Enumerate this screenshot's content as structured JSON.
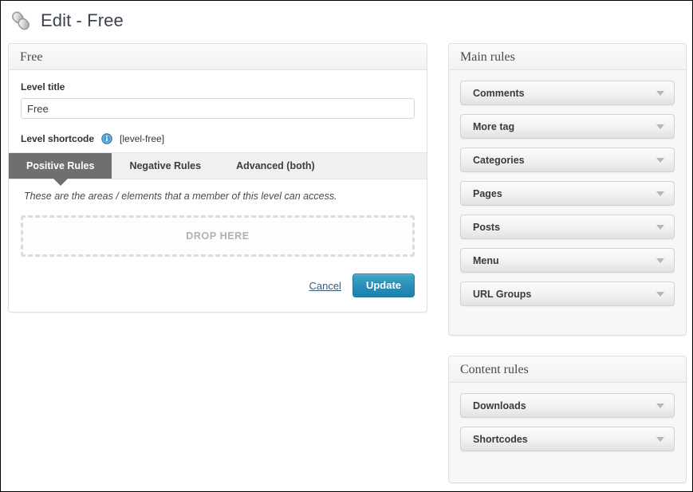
{
  "header": {
    "icon": "chain-link-icon",
    "title": "Edit - Free"
  },
  "left_panel": {
    "title": "Free",
    "level_title_label": "Level title",
    "level_title_value": "Free",
    "level_title_placeholder": "",
    "shortcode_label": "Level shortcode",
    "shortcode_info_icon": "info-icon",
    "shortcode_value": "[level-free]",
    "tabs": [
      {
        "label": "Positive Rules",
        "active": true
      },
      {
        "label": "Negative Rules",
        "active": false
      },
      {
        "label": "Advanced (both)",
        "active": false
      }
    ],
    "hint": "These are the areas / elements that a member of this level can access.",
    "dropzone_label": "DROP HERE",
    "cancel_label": "Cancel",
    "update_label": "Update"
  },
  "sidebar": {
    "main_rules": {
      "title": "Main rules",
      "items": [
        {
          "label": "Comments",
          "chevron": "chevron-down-icon"
        },
        {
          "label": "More tag",
          "chevron": "chevron-down-icon"
        },
        {
          "label": "Categories",
          "chevron": "chevron-down-icon"
        },
        {
          "label": "Pages",
          "chevron": "chevron-down-icon"
        },
        {
          "label": "Posts",
          "chevron": "chevron-down-icon"
        },
        {
          "label": "Menu",
          "chevron": "chevron-down-icon"
        },
        {
          "label": "URL Groups",
          "chevron": "chevron-down-icon"
        }
      ]
    },
    "content_rules": {
      "title": "Content rules",
      "items": [
        {
          "label": "Downloads",
          "chevron": "chevron-down-icon"
        },
        {
          "label": "Shortcodes",
          "chevron": "chevron-down-icon"
        }
      ]
    }
  },
  "colors": {
    "accent_button": "#2a90b8",
    "active_tab": "#6f6f6f",
    "info_icon": "#3c88c4",
    "link": "#3c5a78"
  }
}
